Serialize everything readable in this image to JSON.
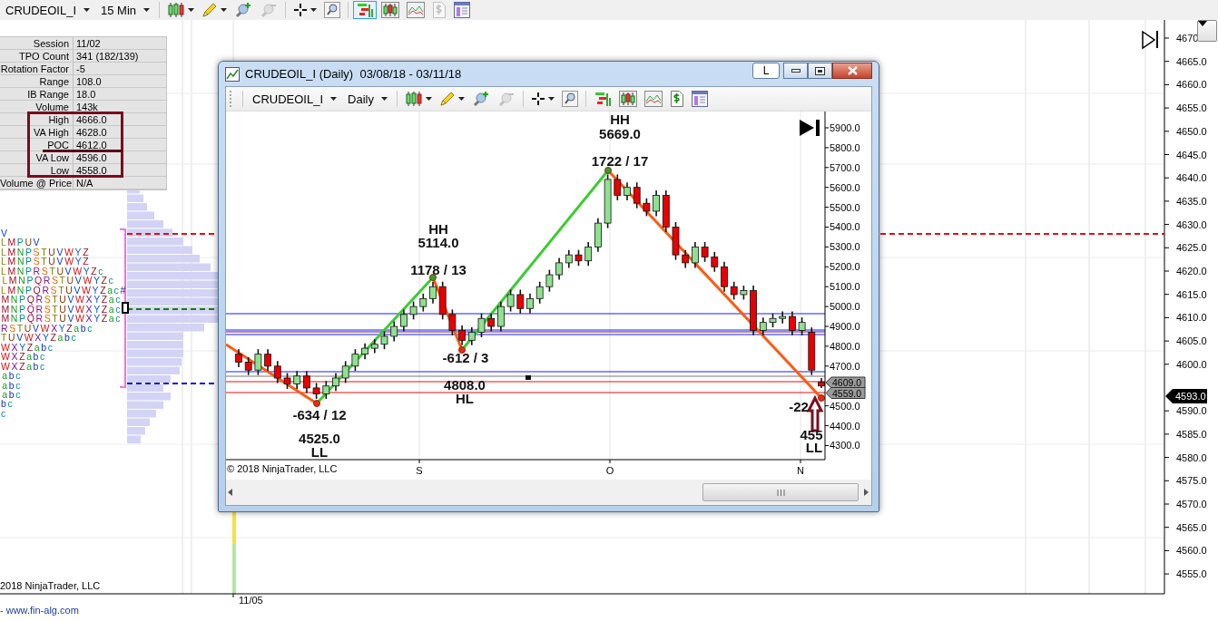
{
  "toolbar": {
    "symbol": "CRUDEOIL_I",
    "interval": "15 Min",
    "tools": [
      {
        "kind": "chart_style",
        "has_menu": true,
        "selected": false,
        "disabled": false
      },
      {
        "kind": "draw",
        "has_menu": true,
        "selected": false,
        "disabled": false
      },
      {
        "kind": "zoom_in",
        "has_menu": false,
        "selected": false,
        "disabled": false
      },
      {
        "kind": "zoom_out",
        "has_menu": false,
        "selected": false,
        "disabled": true
      },
      {
        "kind": "cursor",
        "has_menu": true,
        "selected": false,
        "disabled": false
      },
      {
        "kind": "find",
        "has_menu": false,
        "selected": false,
        "disabled": false
      },
      {
        "kind": "bars",
        "has_menu": false,
        "selected": true,
        "disabled": false
      },
      {
        "kind": "candles",
        "has_menu": false,
        "selected": false,
        "disabled": false
      },
      {
        "kind": "indicators",
        "has_menu": false,
        "selected": false,
        "disabled": false
      },
      {
        "kind": "dollar",
        "has_menu": false,
        "selected": false,
        "disabled": true
      },
      {
        "kind": "layout",
        "has_menu": false,
        "selected": false,
        "disabled": false
      }
    ]
  },
  "stats_table": {
    "rows": [
      {
        "label": "Session",
        "value": "11/02",
        "highlighted": false,
        "underlined": false
      },
      {
        "label": "TPO Count",
        "value": "341 (182/139)",
        "highlighted": false,
        "underlined": false
      },
      {
        "label": "Rotation Factor",
        "value": "-5",
        "highlighted": false,
        "underlined": false
      },
      {
        "label": "Range",
        "value": "108.0",
        "highlighted": false,
        "underlined": false
      },
      {
        "label": "IB Range",
        "value": "18.0",
        "highlighted": false,
        "underlined": false
      },
      {
        "label": "Volume",
        "value": "143k",
        "highlighted": false,
        "underlined": false
      },
      {
        "label": "High",
        "value": "4666.0",
        "highlighted": true,
        "underlined": false
      },
      {
        "label": "VA High",
        "value": "4628.0",
        "highlighted": true,
        "underlined": false
      },
      {
        "label": "POC",
        "value": "4612.0",
        "highlighted": true,
        "underlined": true
      },
      {
        "label": "VA Low",
        "value": "4596.0",
        "highlighted": true,
        "underlined": false
      },
      {
        "label": "Low",
        "value": "4558.0",
        "highlighted": true,
        "underlined": false
      },
      {
        "label": "Volume @ Price",
        "value": "N/A",
        "highlighted": false,
        "underlined": false
      }
    ]
  },
  "tpo_profile": {
    "rows": [
      "V",
      "LMPUV",
      "LMNPSTUVWYZ",
      "LMNPSTUVWYZ",
      "LMNPRSTUVWYZc",
      "LMNPQRSTUVWYZc",
      "LMNPQRSTUVWYZac#",
      "MNPQRSTUVWXYZac",
      "MNPQRSTUVWXYZac",
      "MNPQRSTUVWXYZac",
      "RSTUVWXYZabc",
      "TUVWXYZabc",
      "WXYZabc",
      "WXZabc",
      "WXZabc",
      "abc",
      "abc",
      "abc",
      "bc",
      "c"
    ]
  },
  "price_axis": {
    "labels": [
      "4670",
      "4665.0",
      "4660.0",
      "4655.0",
      "4650.0",
      "4645.0",
      "4640.0",
      "4635.0",
      "4630.0",
      "4625.0",
      "4620.0",
      "4615.0",
      "4610.0",
      "4605.0",
      "4600.0",
      "4590.0",
      "4585.0",
      "4580.0",
      "4575.0",
      "4570.0",
      "4565.0",
      "4560.0",
      "4555.0"
    ],
    "last_price": "4593.0"
  },
  "time_axis": {
    "labels": [
      "11/05"
    ]
  },
  "copyright": "2018 NinjaTrader, LLC",
  "website": "- www.fin-alg.com",
  "chart_window": {
    "title": "CRUDEOIL_I (Daily)  03/08/18 - 03/11/18",
    "link_button": "L",
    "toolbar": {
      "symbol": "CRUDEOIL_I",
      "interval": "Daily",
      "tools": [
        {
          "kind": "chart_style",
          "has_menu": true,
          "selected": false,
          "disabled": false
        },
        {
          "kind": "draw",
          "has_menu": true,
          "selected": false,
          "disabled": false
        },
        {
          "kind": "zoom_in",
          "has_menu": false,
          "selected": false,
          "disabled": false
        },
        {
          "kind": "zoom_out",
          "has_menu": false,
          "selected": false,
          "disabled": true
        },
        {
          "kind": "cursor",
          "has_menu": true,
          "selected": false,
          "disabled": false
        },
        {
          "kind": "find",
          "has_menu": false,
          "selected": false,
          "disabled": false
        },
        {
          "kind": "bars",
          "has_menu": false,
          "selected": false,
          "disabled": false
        },
        {
          "kind": "candles",
          "has_menu": false,
          "selected": false,
          "disabled": false
        },
        {
          "kind": "indicators",
          "has_menu": false,
          "selected": false,
          "disabled": false
        },
        {
          "kind": "dollar",
          "has_menu": false,
          "selected": false,
          "disabled": false
        },
        {
          "kind": "layout",
          "has_menu": false,
          "selected": false,
          "disabled": false
        }
      ]
    },
    "price_axis": {
      "price_tags": [
        "4609.0",
        "4559.0"
      ]
    },
    "time_axis": {
      "labels": [
        "S",
        "O",
        "N"
      ]
    },
    "chart_data": {
      "type": "candlestick",
      "categories": [
        null,
        null,
        null,
        null,
        null,
        null,
        null,
        null,
        null,
        null,
        null,
        null,
        null,
        null,
        null,
        null,
        null,
        null,
        null,
        null,
        null,
        null,
        null,
        null,
        null,
        null,
        null,
        null,
        null,
        null,
        null,
        null,
        null,
        null,
        null,
        null,
        null,
        null,
        null,
        null,
        null,
        null,
        null,
        null,
        null,
        null,
        null,
        null,
        null,
        null,
        null,
        null,
        null,
        null,
        null,
        null,
        null,
        null,
        null,
        null,
        null
      ],
      "ylim": [
        4229,
        5982
      ],
      "yticks": [
        {
          "value": 5900,
          "label": "5900.0"
        },
        {
          "value": 5800,
          "label": "5800.0"
        },
        {
          "value": 5700,
          "label": "5700.0"
        },
        {
          "value": 5600,
          "label": "5600.0"
        },
        {
          "value": 5500,
          "label": "5500.0"
        },
        {
          "value": 5400,
          "label": "5400.0"
        },
        {
          "value": 5300,
          "label": "5300.0"
        },
        {
          "value": 5200,
          "label": "5200.0"
        },
        {
          "value": 5100,
          "label": "5100.0"
        },
        {
          "value": 5000,
          "label": "5000.0"
        },
        {
          "value": 4900,
          "label": "4900.0"
        },
        {
          "value": 4800,
          "label": "4800.0"
        },
        {
          "value": 4700,
          "label": "4700.0"
        },
        {
          "value": 4500,
          "label": "4500.0"
        },
        {
          "value": 4400,
          "label": "4400.0"
        },
        {
          "value": 4300,
          "label": "4300.0"
        }
      ],
      "ohlc": [
        [
          4760,
          4785,
          4695,
          4720
        ],
        [
          4720,
          4745,
          4655,
          4680
        ],
        [
          4680,
          4785,
          4655,
          4760
        ],
        [
          4760,
          4785,
          4675,
          4700
        ],
        [
          4700,
          4725,
          4615,
          4640
        ],
        [
          4640,
          4665,
          4585,
          4610
        ],
        [
          4610,
          4675,
          4585,
          4650
        ],
        [
          4650,
          4675,
          4565,
          4590
        ],
        [
          4590,
          4615,
          4535,
          4560
        ],
        [
          4560,
          4625,
          4535,
          4600
        ],
        [
          4600,
          4665,
          4575,
          4640
        ],
        [
          4640,
          4725,
          4615,
          4700
        ],
        [
          4700,
          4785,
          4675,
          4760
        ],
        [
          4760,
          4815,
          4735,
          4790
        ],
        [
          4790,
          4835,
          4765,
          4810
        ],
        [
          4810,
          4875,
          4785,
          4850
        ],
        [
          4850,
          4925,
          4825,
          4900
        ],
        [
          4900,
          4985,
          4875,
          4960
        ],
        [
          4960,
          5025,
          4935,
          5000
        ],
        [
          5000,
          5065,
          4975,
          5040
        ],
        [
          5040,
          5125,
          5015,
          5100
        ],
        [
          5100,
          5125,
          4935,
          4960
        ],
        [
          4960,
          4985,
          4855,
          4880
        ],
        [
          4880,
          4905,
          4805,
          4830
        ],
        [
          4830,
          4895,
          4805,
          4870
        ],
        [
          4870,
          4965,
          4845,
          4940
        ],
        [
          4940,
          4965,
          4875,
          4900
        ],
        [
          4900,
          5025,
          4875,
          5000
        ],
        [
          5000,
          5085,
          4975,
          5060
        ],
        [
          5060,
          5085,
          4965,
          4990
        ],
        [
          4990,
          5065,
          4965,
          5040
        ],
        [
          5040,
          5125,
          5015,
          5100
        ],
        [
          5100,
          5185,
          5075,
          5160
        ],
        [
          5160,
          5245,
          5135,
          5220
        ],
        [
          5220,
          5285,
          5195,
          5260
        ],
        [
          5260,
          5285,
          5205,
          5230
        ],
        [
          5230,
          5325,
          5205,
          5300
        ],
        [
          5300,
          5445,
          5275,
          5420
        ],
        [
          5420,
          5665,
          5395,
          5640
        ],
        [
          5640,
          5665,
          5535,
          5560
        ],
        [
          5560,
          5625,
          5535,
          5600
        ],
        [
          5600,
          5625,
          5495,
          5520
        ],
        [
          5520,
          5545,
          5455,
          5480
        ],
        [
          5480,
          5585,
          5455,
          5560
        ],
        [
          5560,
          5585,
          5375,
          5400
        ],
        [
          5400,
          5425,
          5235,
          5260
        ],
        [
          5260,
          5285,
          5195,
          5220
        ],
        [
          5220,
          5325,
          5195,
          5300
        ],
        [
          5300,
          5325,
          5225,
          5250
        ],
        [
          5250,
          5275,
          5175,
          5200
        ],
        [
          5200,
          5225,
          5075,
          5100
        ],
        [
          5100,
          5125,
          5035,
          5060
        ],
        [
          5060,
          5105,
          5035,
          5080
        ],
        [
          5080,
          5105,
          4855,
          4880
        ],
        [
          4880,
          4945,
          4855,
          4920
        ],
        [
          4920,
          4965,
          4895,
          4940
        ],
        [
          4940,
          4975,
          4915,
          4950
        ],
        [
          4950,
          4975,
          4855,
          4880
        ],
        [
          4880,
          4945,
          4855,
          4920
        ],
        [
          4870,
          4895,
          4655,
          4680
        ],
        [
          4620,
          4640,
          4590,
          4600
        ]
      ]
    },
    "swing_labels": [
      "HH",
      "5114.0",
      "1178 / 13",
      "HH",
      "5669.0",
      "1722 / 17",
      "-612 / 3",
      "4808.0",
      "HL",
      "-634 / 12",
      "4525.0",
      "LL",
      "-22",
      "455",
      "LL"
    ],
    "copyright": "© 2018 NinjaTrader, LLC"
  }
}
